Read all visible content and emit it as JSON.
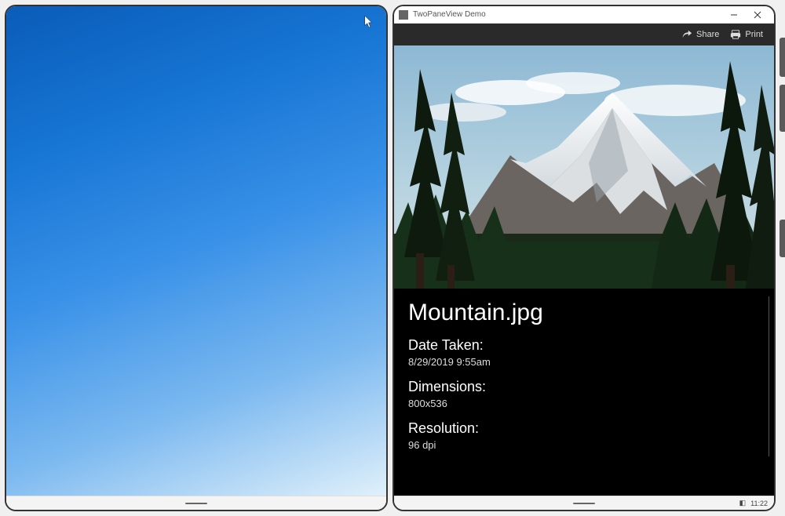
{
  "window": {
    "title": "TwoPaneView Demo"
  },
  "toolbar": {
    "share": "Share",
    "print": "Print"
  },
  "file": {
    "name": "Mountain.jpg"
  },
  "meta": {
    "date_label": "Date Taken:",
    "date_value": "8/29/2019 9:55am",
    "dimensions_label": "Dimensions:",
    "dimensions_value": "800x536",
    "resolution_label": "Resolution:",
    "resolution_value": "96 dpi"
  },
  "taskbar": {
    "time": "11:22"
  }
}
